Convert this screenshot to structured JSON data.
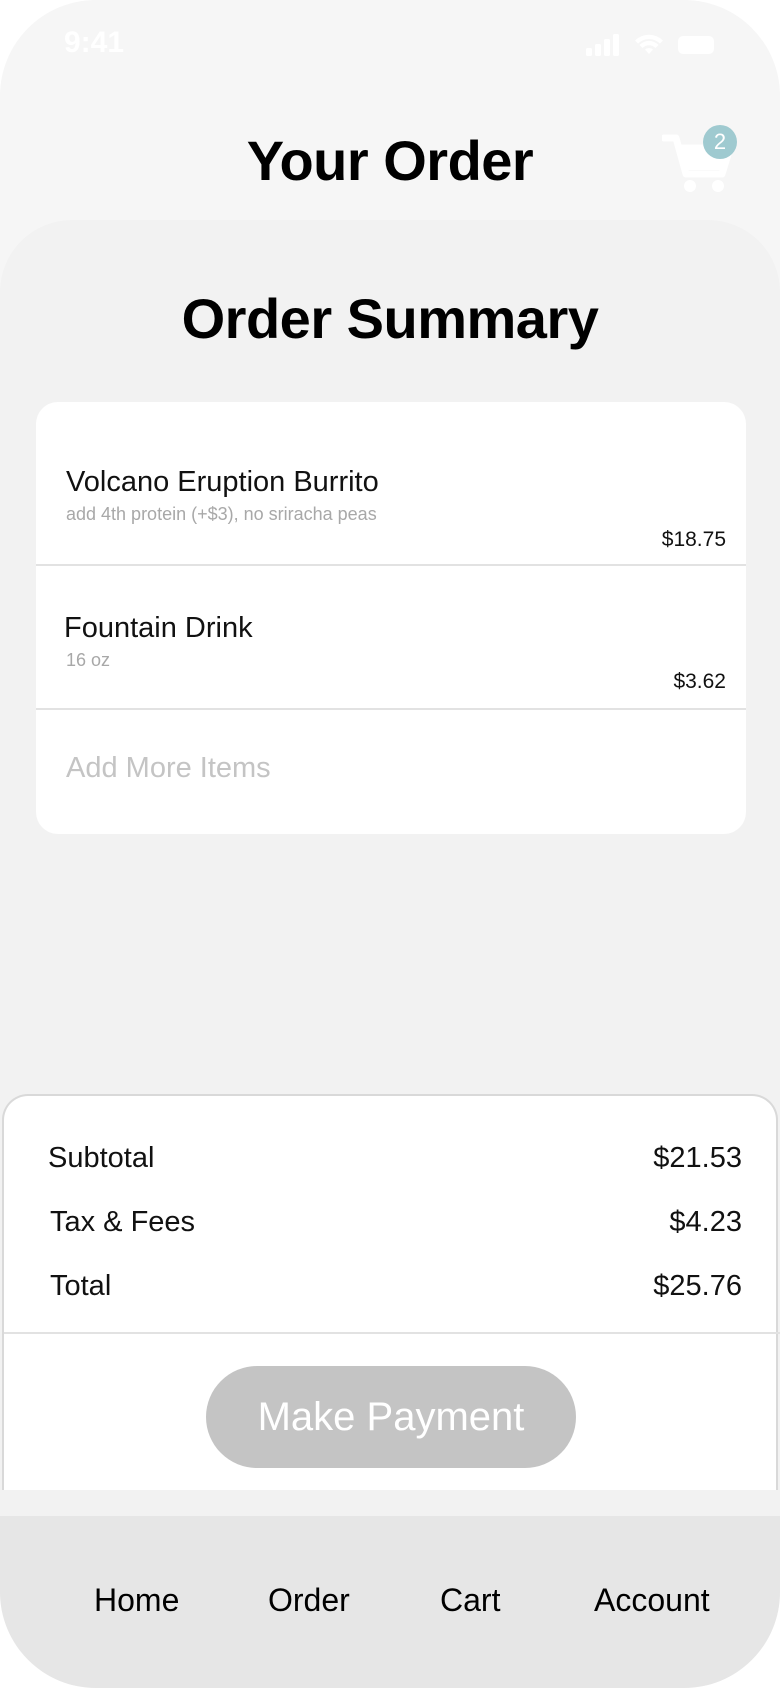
{
  "status_bar": {
    "time": "9:41"
  },
  "header": {
    "title": "Your Order",
    "cart_count": "2"
  },
  "summary": {
    "title": "Order Summary",
    "items": [
      {
        "name": "Volcano Eruption Burrito",
        "description": "add 4th protein (+$3), no sriracha peas",
        "price": "$18.75"
      },
      {
        "name": "Fountain Drink",
        "description": "16 oz",
        "price": "$3.62"
      }
    ],
    "add_more_label": "Add More Items"
  },
  "totals": {
    "subtotal_label": "Subtotal",
    "subtotal_value": "$21.53",
    "tax_label": "Tax & Fees",
    "tax_value": "$4.23",
    "total_label": "Total",
    "total_value": "$25.76",
    "pay_label": "Make Payment"
  },
  "nav": {
    "items": [
      {
        "label": "Home"
      },
      {
        "label": "Order"
      },
      {
        "label": "Cart"
      },
      {
        "label": "Account"
      }
    ]
  },
  "colors": {
    "badge": "#9fcad0",
    "button_disabled": "#c4c4c4",
    "muted_text": "#a8a8a8"
  }
}
